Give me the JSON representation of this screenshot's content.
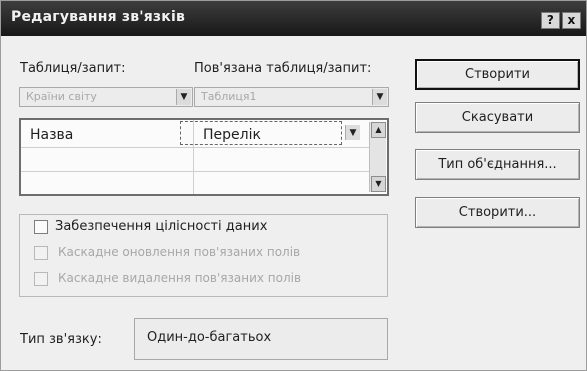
{
  "window": {
    "title": "Редагування зв'язків",
    "help_label": "?",
    "close_label": "x"
  },
  "tables": {
    "table_label": "Таблиця/запит:",
    "related_label": "Пов'язана таблиця/запит:",
    "table_value": "Країни світу",
    "related_value": "Таблиця1"
  },
  "fields_grid": {
    "left_field": "Назва",
    "right_field": "Перелік"
  },
  "integrity": {
    "enforce_label": "Забезпечення цілісності даних",
    "cascade_update_label": "Каскадне оновлення пов'язаних полів",
    "cascade_delete_label": "Каскадне видалення пов'язаних полів",
    "enforce_checked": false,
    "cascade_update_checked": false,
    "cascade_delete_checked": false
  },
  "relationship": {
    "type_label": "Тип зв'язку:",
    "type_value": "Один-до-багатьох"
  },
  "buttons": {
    "create": "Створити",
    "cancel": "Скасувати",
    "join_type": "Тип об'єднання...",
    "create_new": "Створити..."
  }
}
